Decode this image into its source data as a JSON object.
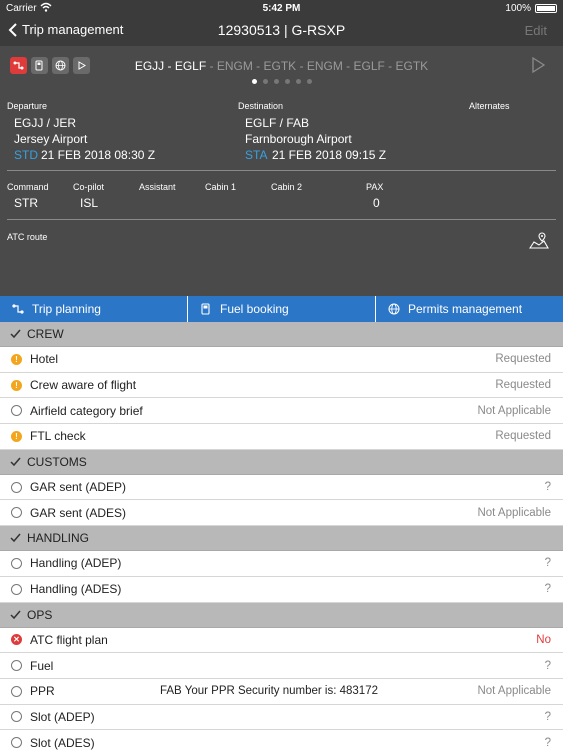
{
  "status_bar": {
    "carrier": "Carrier",
    "time": "5:42 PM",
    "battery": "100%"
  },
  "nav": {
    "back_label": "Trip management",
    "title": "12930513 | G-RSXP",
    "edit_label": "Edit"
  },
  "route": {
    "current_leg": "EGJJ - EGLF",
    "remaining": " - ENGM - EGTK - ENGM - EGLF - EGTK"
  },
  "departure": {
    "label": "Departure",
    "codes": "EGJJ / JER",
    "airport": "Jersey Airport",
    "time_label": "STD",
    "time": "21 FEB 2018  08:30 Z"
  },
  "destination": {
    "label": "Destination",
    "codes": "EGLF / FAB",
    "airport": "Farnborough Airport",
    "time_label": "STA",
    "time": "21 FEB 2018  09:15 Z"
  },
  "alternates": {
    "label": "Alternates"
  },
  "crew_fields": {
    "command": {
      "label": "Command",
      "value": "STR"
    },
    "copilot": {
      "label": "Co-pilot",
      "value": "ISL"
    },
    "assistant": {
      "label": "Assistant"
    },
    "cabin1": {
      "label": "Cabin 1"
    },
    "cabin2": {
      "label": "Cabin 2"
    },
    "pax": {
      "label": "PAX",
      "value": "0"
    }
  },
  "atc_route": {
    "label": "ATC route"
  },
  "tabs": [
    "Trip planning",
    "Fuel booking",
    "Permits management"
  ],
  "sections": {
    "crew": {
      "title": "CREW",
      "rows": [
        {
          "label": "Hotel",
          "value": "Requested"
        },
        {
          "label": "Crew aware of flight",
          "value": "Requested"
        },
        {
          "label": "Airfield category brief",
          "value": "Not Applicable"
        },
        {
          "label": "FTL check",
          "value": "Requested"
        }
      ]
    },
    "customs": {
      "title": "CUSTOMS",
      "rows": [
        {
          "label": "GAR sent (ADEP)",
          "value": "?"
        },
        {
          "label": "GAR sent (ADES)",
          "value": "Not Applicable"
        }
      ]
    },
    "handling": {
      "title": "HANDLING",
      "rows": [
        {
          "label": "Handling (ADEP)",
          "value": "?"
        },
        {
          "label": "Handling (ADES)",
          "value": "?"
        }
      ]
    },
    "ops": {
      "title": "OPS",
      "rows": [
        {
          "label": "ATC flight plan",
          "value": "No"
        },
        {
          "label": "Fuel",
          "value": "?"
        },
        {
          "label": "PPR",
          "note": "FAB Your PPR Security number is: 483172",
          "value": "Not Applicable"
        },
        {
          "label": "Slot (ADEP)",
          "value": "?"
        },
        {
          "label": "Slot (ADES)",
          "value": "?"
        }
      ]
    }
  },
  "colors": {
    "accent": "#39a0e0",
    "tab_bar": "#2b76c6",
    "warning": "#f3a51d",
    "error": "#e03b3b"
  }
}
